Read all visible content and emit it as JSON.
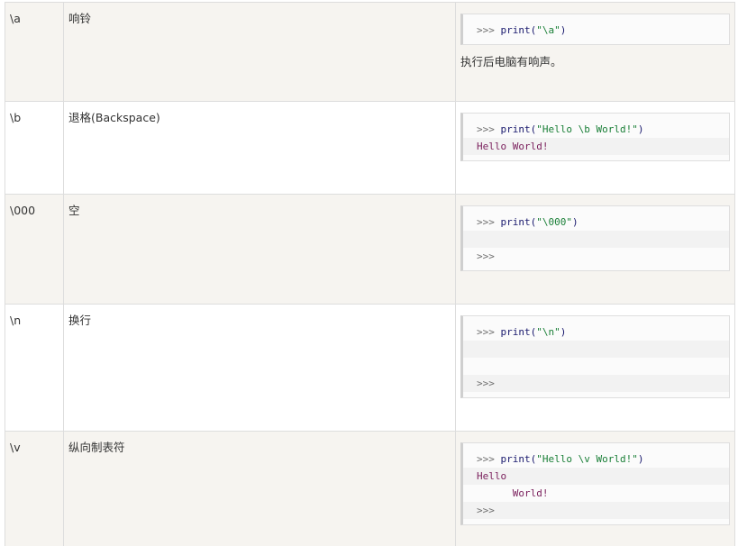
{
  "rows": [
    {
      "seq": "\\a",
      "desc": "响铃",
      "code": [
        [
          {
            "t": ">>> ",
            "c": "prompt"
          },
          {
            "t": "print(",
            "c": "kw"
          },
          {
            "t": "\"\\a\"",
            "c": "str"
          },
          {
            "t": ")",
            "c": "kw"
          }
        ]
      ],
      "note": "执行后电脑有响声。"
    },
    {
      "seq": "\\b",
      "desc": "退格(Backspace)",
      "code": [
        [
          {
            "t": ">>> ",
            "c": "prompt"
          },
          {
            "t": "print(",
            "c": "kw"
          },
          {
            "t": "\"Hello \\b World!\"",
            "c": "str"
          },
          {
            "t": ")",
            "c": "kw"
          }
        ],
        [
          {
            "t": "Hello World!",
            "c": "out"
          }
        ]
      ],
      "note": ""
    },
    {
      "seq": "\\000",
      "desc": "空",
      "code": [
        [
          {
            "t": ">>> ",
            "c": "prompt"
          },
          {
            "t": "print(",
            "c": "kw"
          },
          {
            "t": "\"\\000\"",
            "c": "str"
          },
          {
            "t": ")",
            "c": "kw"
          }
        ],
        [],
        [
          {
            "t": ">>>",
            "c": "prompt"
          }
        ]
      ],
      "note": ""
    },
    {
      "seq": "\\n",
      "desc": "换行",
      "code": [
        [
          {
            "t": ">>> ",
            "c": "prompt"
          },
          {
            "t": "print(",
            "c": "kw"
          },
          {
            "t": "\"\\n\"",
            "c": "str"
          },
          {
            "t": ")",
            "c": "kw"
          }
        ],
        [],
        [],
        [
          {
            "t": ">>>",
            "c": "prompt"
          }
        ]
      ],
      "note": ""
    },
    {
      "seq": "\\v",
      "desc": "纵向制表符",
      "code": [
        [
          {
            "t": ">>> ",
            "c": "prompt"
          },
          {
            "t": "print(",
            "c": "kw"
          },
          {
            "t": "\"Hello \\v World!\"",
            "c": "str"
          },
          {
            "t": ")",
            "c": "kw"
          }
        ],
        [
          {
            "t": "Hello",
            "c": "out"
          }
        ],
        [
          {
            "t": "      World!",
            "c": "out"
          }
        ],
        [
          {
            "t": ">>>",
            "c": "prompt"
          }
        ]
      ],
      "note": ""
    }
  ]
}
